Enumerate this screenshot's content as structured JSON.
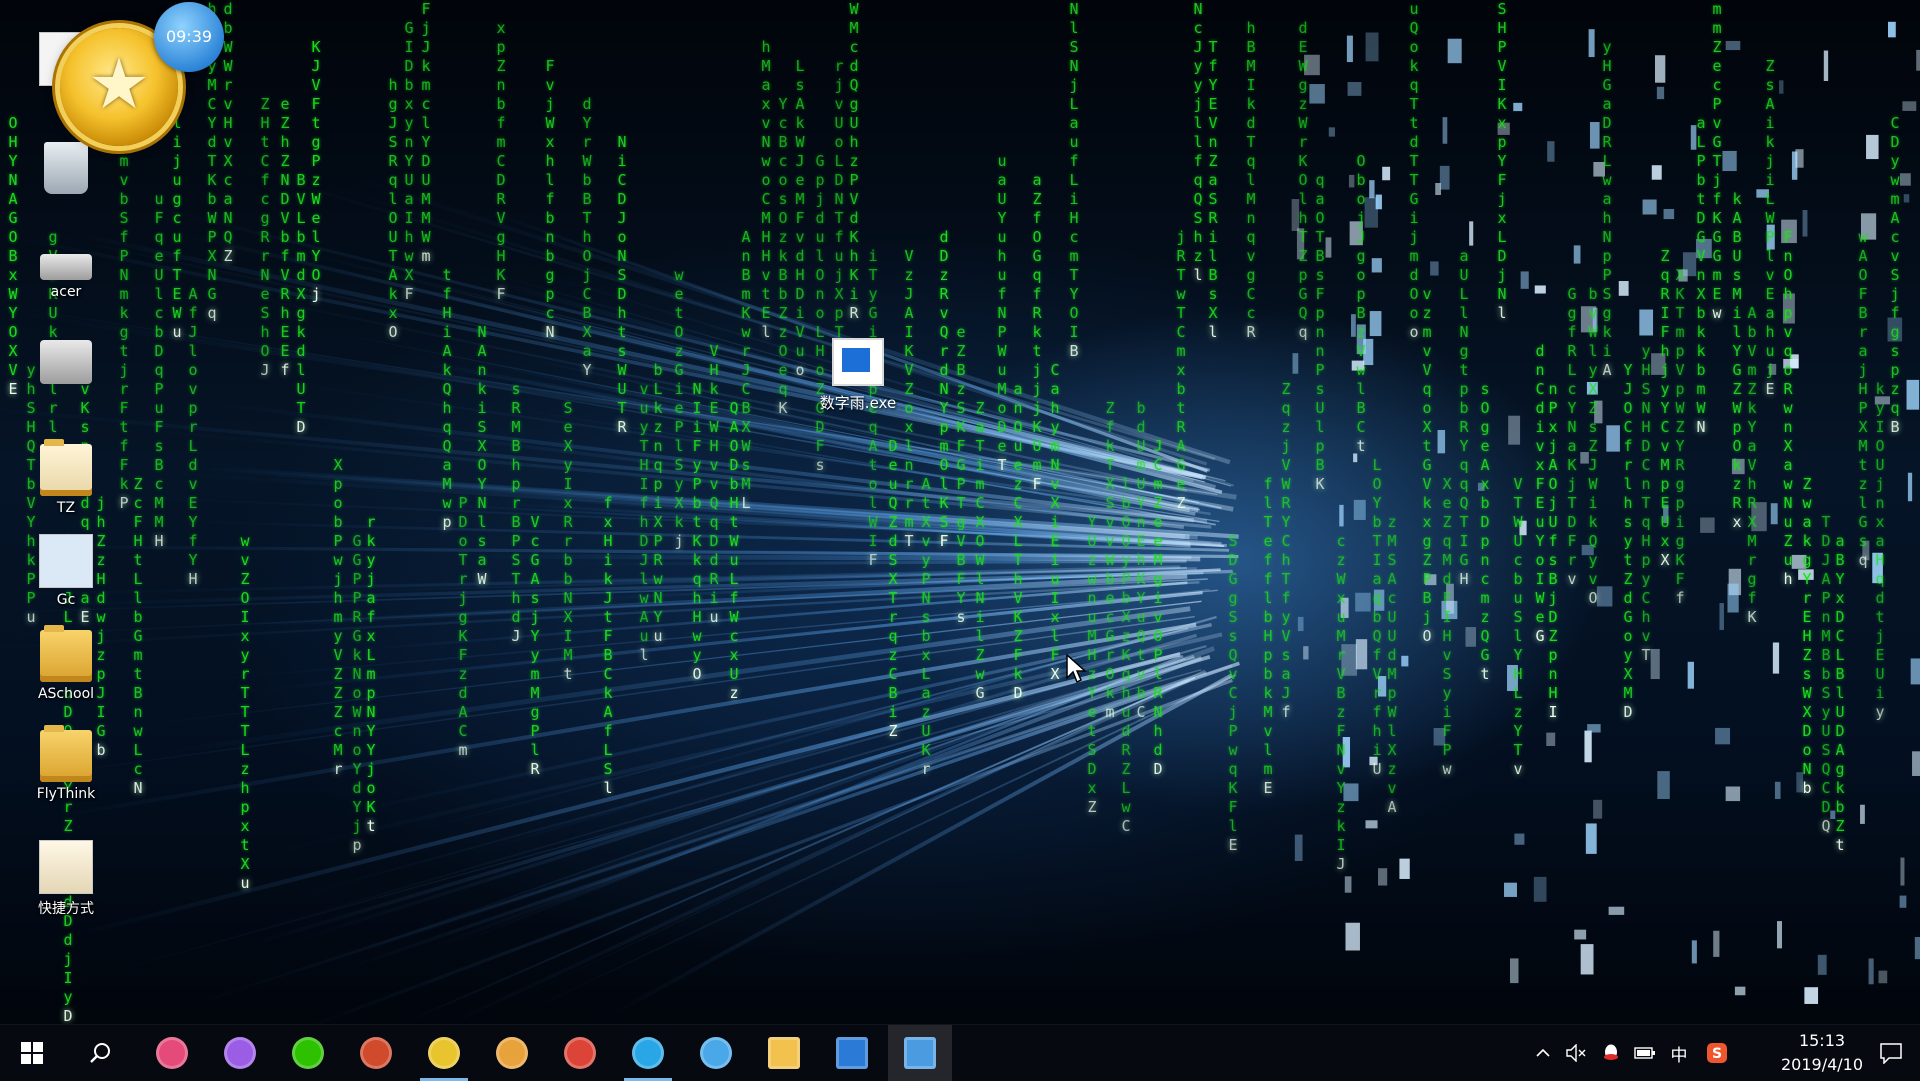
{
  "desktop": {
    "clock_widget": "09:39",
    "icons": [
      {
        "label": "",
        "kind": "doc"
      },
      {
        "label": "",
        "kind": "recycle"
      },
      {
        "label": "acer",
        "kind": "drive"
      },
      {
        "label": "",
        "kind": "drive"
      },
      {
        "label": "TZ",
        "kind": "folder"
      },
      {
        "label": "Gc",
        "kind": "doc"
      },
      {
        "label": "ASchool",
        "kind": "folder"
      },
      {
        "label": "FlyThink",
        "kind": "folder"
      },
      {
        "label": "快捷方式",
        "kind": "doc"
      }
    ],
    "exe_label": "数字雨.exe"
  },
  "matrix_rain": {
    "color": "#1fdc1f",
    "head_color": "#f2fff2",
    "columns": [
      {
        "chars": "OHYNAGOBxWYOXVE"
      },
      {
        "chars": "yhSHQTbVYhkPPu"
      },
      {
        "chars": "gVzKUkSFlrlIyB"
      },
      {
        "chars": "AOuJLpZEuDOWTYrZoSVdDdjIyD"
      },
      {
        "chars": "IvKsnuEdqeFkaE"
      },
      {
        "chars": "jhZzHdwjzpJIGb"
      },
      {
        "chars": "oZjcmvbSfPNmkgtjrFtfFkP"
      },
      {
        "chars": "ZcFHtLlbGmtBnwLcN"
      },
      {
        "chars": "uFqeUlcbDqPuFsBcMMH"
      },
      {
        "chars": "LvKlijugcufTEWu"
      },
      {
        "chars": "AfJlovprLdvEYfYH"
      },
      {
        "chars": "hKkyMCYdTKbWPXNGq"
      },
      {
        "chars": "dbWWrvHvXcaNQZ"
      },
      {
        "chars": "wvZOIxyrTTTLzhpxtXu"
      },
      {
        "chars": "ZHtCfcgRrNeShOJ"
      },
      {
        "chars": "eZhZNDVbfVRhEEf"
      },
      {
        "chars": "BVLbmdXgkdlUTD"
      },
      {
        "chars": "KJVFtgPzWelYOj"
      },
      {
        "chars": "XpobPwjhmyVZZZcMr"
      },
      {
        "chars": "GGPPRGkNoWnoYdYjp"
      },
      {
        "chars": "rkyjafxLmpNYYjoKt"
      },
      {
        "chars": "hgJSRqlOUTAkxO"
      },
      {
        "chars": "GIDbxynYUaIhwXF"
      },
      {
        "chars": "FjJkmclYDUMMWm"
      },
      {
        "chars": "tfHiAkQhqQaMwp"
      },
      {
        "chars": "PDoTrjgKFzdACm"
      },
      {
        "chars": "NAnkiSXOYNlsaW"
      },
      {
        "chars": "xpZnbfmCDRVgHKF"
      },
      {
        "chars": "sRMBhprBPSThdJ"
      },
      {
        "chars": "VcGAsjYymMgPlR"
      },
      {
        "chars": "FvjWxhlfbnbgpcN"
      },
      {
        "chars": "SeXyIxRrbbNXIMt"
      },
      {
        "chars": "dYrWbBThOjCBXaY"
      },
      {
        "chars": "fxHikJtFBCkAfLSl"
      },
      {
        "chars": "NiCDJoNSDhtsWUTR"
      },
      {
        "chars": "vuyTHIfhDJlwAul"
      },
      {
        "chars": "bLkznqpiXPRwNYu"
      },
      {
        "chars": "wetOzGiePlSyXkj"
      },
      {
        "chars": "NIiFyPbtKkqhHwyO"
      },
      {
        "chars": "VHkEWHvvQqDdRiu"
      },
      {
        "chars": "QAODbHtWuLfWcxUz"
      },
      {
        "chars": "AnBmKwrJCBXWsML"
      },
      {
        "chars": "hMaxvNwoCMHHvtEl"
      },
      {
        "chars": "YcBcosOzkBbZzOeqK"
      },
      {
        "chars": "LsAkWJeMFvdHDiVuo"
      },
      {
        "chars": "GpjdulOnoLHoZGDFs"
      },
      {
        "chars": "rjvUoLDNTfujXpTR"
      },
      {
        "chars": "WMcdQgUhzPVdKhKiR"
      },
      {
        "chars": "iTyGiGnpeqAtolWIF"
      },
      {
        "chars": "DeuQZdSXTrqzCBiZ"
      },
      {
        "chars": "VzJAIKVZoxlnrrmT"
      },
      {
        "chars": "AtXvyPNsbxLazUKr"
      },
      {
        "chars": "dDzRvQrdNYpmOlKSF"
      },
      {
        "chars": "eZBzSKFGPTgVBFYs"
      },
      {
        "chars": "ZaTimCXOWlNilZwG"
      },
      {
        "chars": "uaUYuhufNPWuMoDeT"
      },
      {
        "chars": "anOuezCXLThVKZFkD"
      },
      {
        "chars": "aZfOGqfRktjjjKUmF"
      },
      {
        "chars": "CahymNvXiEiuIxlFX"
      },
      {
        "chars": "NlSNjLaufLiHcmTYOIB"
      },
      {
        "chars": "YUzwnuMHzYetSDxZ"
      },
      {
        "chars": "ZfkTXSvvWbecGrOkm"
      },
      {
        "chars": "lbOOyPbXzKqhudRZLwC"
      },
      {
        "chars": "bdUmUYnEhKYuQtvbC"
      },
      {
        "chars": "JCmZeeMgivOPlRNhdD"
      },
      {
        "chars": "jRTwTCmxbtRAGeZ"
      },
      {
        "chars": "NcJyyjllfqQShzl"
      },
      {
        "chars": "TfYEVnZaSRilBsXl"
      },
      {
        "chars": "SDGgSsQvCjPwqKFlE"
      },
      {
        "chars": "hBMIkdTqlMnqvgCcR"
      },
      {
        "chars": "flTefflbHpbkMvlmE"
      },
      {
        "chars": "ZqzjVWRYChTfyVsaJf"
      },
      {
        "chars": "dEWgzWrKOlhTZpGQq"
      },
      {
        "chars": "qaOTBsFpnnPsUlpBK"
      },
      {
        "chars": "czWxuMrVBzFNvYzkIJ"
      },
      {
        "chars": "ObojJgopBzVwlBCt"
      },
      {
        "chars": "LOYbTIaqbQfVrfhiU"
      },
      {
        "chars": "zMSAcUUdMpWlXzvA"
      },
      {
        "chars": "uQokqTtdTTGijmdOoo"
      },
      {
        "chars": "vzmvVqoXtGVkxgZPBjO"
      },
      {
        "chars": "XeZqMdFIHvSyiFPw"
      },
      {
        "chars": "aULlNgtpbRYqqQTIGH"
      },
      {
        "chars": "sOgeAxbDpncmzQGt"
      },
      {
        "chars": "SHPVIKxpYFjxLDjNl"
      },
      {
        "chars": "VTWUcbuSlYHLzYTv"
      },
      {
        "chars": "dnCdivxFEuYoIWeG"
      },
      {
        "chars": "nPxjAOjUfsBjDZpnHI"
      },
      {
        "chars": "GgfRLcYNaKjTDFrv"
      },
      {
        "chars": "bvWlyXZsZJWikQyvO"
      },
      {
        "chars": "yHGaDRLwahNpPSgkiA"
      },
      {
        "chars": "YJOCfrlhsytZdGoyXMD"
      },
      {
        "chars": "yHSNHDCnTqHpyChvT"
      },
      {
        "chars": "ZqRIFhjyYCvMpEUxX"
      },
      {
        "chars": "XKTmpVpWZYRgpigKFf"
      },
      {
        "chars": "aLPbtDGVnXbkkbmWN"
      },
      {
        "chars": "mmZecPvGTjfKGGmEw"
      },
      {
        "chars": "kABUsMilYGZWpOkzRx"
      },
      {
        "chars": "AbVmZkYaVhRXMrgfK"
      },
      {
        "chars": "ZsAikjiLWPlvEahujE"
      },
      {
        "chars": "FnOhpvqoRwnXawNuZuh"
      },
      {
        "chars": "ZwakgYrEHZsWXDoNb"
      },
      {
        "chars": "TDJAPnMBbSyUSQCDQ"
      },
      {
        "chars": "aBYxDCLBlUDAgkbZt"
      },
      {
        "chars": "wAOFBrajHPXMtzlGsq"
      },
      {
        "chars": "kyIOUjnxaHqdtjEUiy"
      },
      {
        "chars": "CDywmAcvSjfgspzqB"
      }
    ]
  },
  "taskbar": {
    "start_icon": "windows-logo-icon",
    "search_icon": "search-icon",
    "apps": [
      {
        "name": "people-icon",
        "color": "#e44b7a",
        "active": false
      },
      {
        "name": "visual-studio-icon",
        "color": "#9b5de5",
        "active": false
      },
      {
        "name": "wechat-icon",
        "color": "#2dc100",
        "active": false
      },
      {
        "name": "toolbox-icon",
        "color": "#d04a2c",
        "active": false
      },
      {
        "name": "music-icon",
        "color": "#e8c52f",
        "active": true
      },
      {
        "name": "paint-icon",
        "color": "#e8a23c",
        "active": false
      },
      {
        "name": "chrome-icon",
        "color": "#db4437",
        "active": false
      },
      {
        "name": "search-app-icon",
        "color": "#29a6e6",
        "active": true
      },
      {
        "name": "browser-icon",
        "color": "#4aa8e8",
        "active": false
      },
      {
        "name": "file-explorer-icon",
        "color": "#f2c14e",
        "active": false
      },
      {
        "name": "window-app-icon",
        "color": "#2b7bd6",
        "active": false
      },
      {
        "name": "window-app-open-icon",
        "color": "#4b9be0",
        "active": false,
        "open": true
      }
    ],
    "tray": {
      "chevron_icon": "chevron-up-icon",
      "volume_icon": "volume-muted-icon",
      "qq_icon": "qq-icon",
      "battery_icon": "battery-icon",
      "ime": "中",
      "sogou_icon": "sogou-icon",
      "time": "15:13",
      "date": "2019/4/10",
      "notification_icon": "notification-icon"
    }
  }
}
